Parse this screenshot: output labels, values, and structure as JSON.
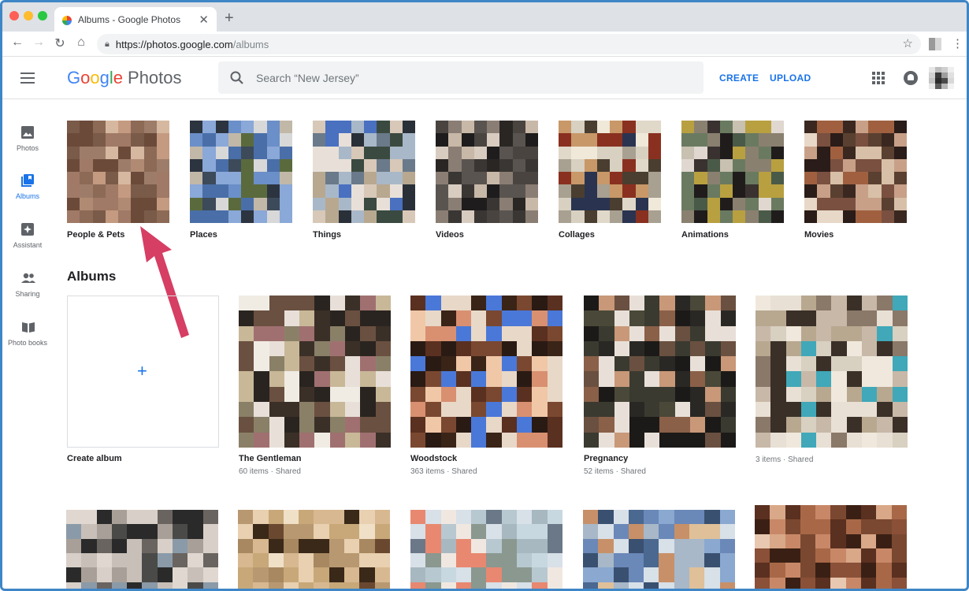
{
  "browser": {
    "tab_title": "Albums - Google Photos",
    "tab_close": "✕",
    "new_tab": "+",
    "url_host": "https://photos.google.com",
    "url_path": "/albums"
  },
  "header": {
    "logo_google": [
      "G",
      "o",
      "o",
      "g",
      "l",
      "e"
    ],
    "logo_product": "Photos",
    "search_placeholder": "Search “New Jersey”",
    "create": "CREATE",
    "upload": "UPLOAD"
  },
  "sidebar": {
    "items": [
      {
        "label": "Photos",
        "icon": "photo-icon"
      },
      {
        "label": "Albums",
        "icon": "albums-icon",
        "active": true
      },
      {
        "label": "Assistant",
        "icon": "assistant-icon"
      },
      {
        "label": "Sharing",
        "icon": "sharing-icon"
      },
      {
        "label": "Photo books",
        "icon": "photo-books-icon"
      }
    ]
  },
  "categories": [
    {
      "label": "People & Pets"
    },
    {
      "label": "Places"
    },
    {
      "label": "Things"
    },
    {
      "label": "Videos"
    },
    {
      "label": "Collages"
    },
    {
      "label": "Animations"
    },
    {
      "label": "Movies"
    }
  ],
  "albums_section": {
    "title": "Albums",
    "create_plus": "+",
    "create_label": "Create album",
    "albums": [
      {
        "name": "The Gentleman",
        "count": "60 items",
        "sep": "·",
        "shared": "Shared"
      },
      {
        "name": "Woodstock",
        "count": "363 items",
        "sep": "·",
        "shared": "Shared"
      },
      {
        "name": "Pregnancy",
        "count": "52 items",
        "sep": "·",
        "shared": "Shared"
      },
      {
        "name": "",
        "count": "3 items",
        "sep": "·",
        "shared": "Shared"
      }
    ]
  },
  "colors": {
    "accent": "#1a73e8",
    "annotation_arrow": "#d63e63",
    "frame_border": "#3f86c6"
  }
}
